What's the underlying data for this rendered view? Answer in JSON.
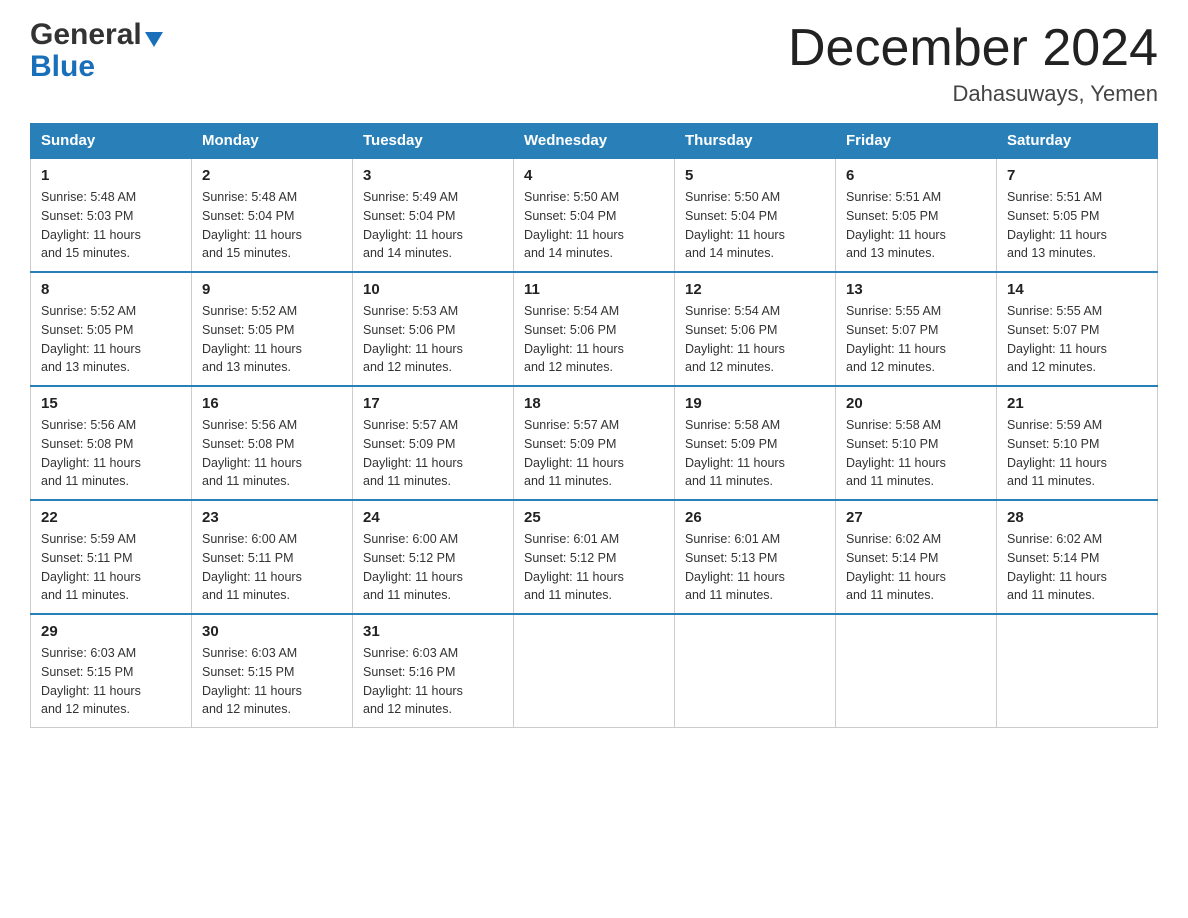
{
  "logo": {
    "general": "General",
    "blue": "Blue"
  },
  "title": "December 2024",
  "location": "Dahasuways, Yemen",
  "headers": [
    "Sunday",
    "Monday",
    "Tuesday",
    "Wednesday",
    "Thursday",
    "Friday",
    "Saturday"
  ],
  "weeks": [
    [
      {
        "day": "1",
        "sunrise": "5:48 AM",
        "sunset": "5:03 PM",
        "daylight": "11 hours and 15 minutes."
      },
      {
        "day": "2",
        "sunrise": "5:48 AM",
        "sunset": "5:04 PM",
        "daylight": "11 hours and 15 minutes."
      },
      {
        "day": "3",
        "sunrise": "5:49 AM",
        "sunset": "5:04 PM",
        "daylight": "11 hours and 14 minutes."
      },
      {
        "day": "4",
        "sunrise": "5:50 AM",
        "sunset": "5:04 PM",
        "daylight": "11 hours and 14 minutes."
      },
      {
        "day": "5",
        "sunrise": "5:50 AM",
        "sunset": "5:04 PM",
        "daylight": "11 hours and 14 minutes."
      },
      {
        "day": "6",
        "sunrise": "5:51 AM",
        "sunset": "5:05 PM",
        "daylight": "11 hours and 13 minutes."
      },
      {
        "day": "7",
        "sunrise": "5:51 AM",
        "sunset": "5:05 PM",
        "daylight": "11 hours and 13 minutes."
      }
    ],
    [
      {
        "day": "8",
        "sunrise": "5:52 AM",
        "sunset": "5:05 PM",
        "daylight": "11 hours and 13 minutes."
      },
      {
        "day": "9",
        "sunrise": "5:52 AM",
        "sunset": "5:05 PM",
        "daylight": "11 hours and 13 minutes."
      },
      {
        "day": "10",
        "sunrise": "5:53 AM",
        "sunset": "5:06 PM",
        "daylight": "11 hours and 12 minutes."
      },
      {
        "day": "11",
        "sunrise": "5:54 AM",
        "sunset": "5:06 PM",
        "daylight": "11 hours and 12 minutes."
      },
      {
        "day": "12",
        "sunrise": "5:54 AM",
        "sunset": "5:06 PM",
        "daylight": "11 hours and 12 minutes."
      },
      {
        "day": "13",
        "sunrise": "5:55 AM",
        "sunset": "5:07 PM",
        "daylight": "11 hours and 12 minutes."
      },
      {
        "day": "14",
        "sunrise": "5:55 AM",
        "sunset": "5:07 PM",
        "daylight": "11 hours and 12 minutes."
      }
    ],
    [
      {
        "day": "15",
        "sunrise": "5:56 AM",
        "sunset": "5:08 PM",
        "daylight": "11 hours and 11 minutes."
      },
      {
        "day": "16",
        "sunrise": "5:56 AM",
        "sunset": "5:08 PM",
        "daylight": "11 hours and 11 minutes."
      },
      {
        "day": "17",
        "sunrise": "5:57 AM",
        "sunset": "5:09 PM",
        "daylight": "11 hours and 11 minutes."
      },
      {
        "day": "18",
        "sunrise": "5:57 AM",
        "sunset": "5:09 PM",
        "daylight": "11 hours and 11 minutes."
      },
      {
        "day": "19",
        "sunrise": "5:58 AM",
        "sunset": "5:09 PM",
        "daylight": "11 hours and 11 minutes."
      },
      {
        "day": "20",
        "sunrise": "5:58 AM",
        "sunset": "5:10 PM",
        "daylight": "11 hours and 11 minutes."
      },
      {
        "day": "21",
        "sunrise": "5:59 AM",
        "sunset": "5:10 PM",
        "daylight": "11 hours and 11 minutes."
      }
    ],
    [
      {
        "day": "22",
        "sunrise": "5:59 AM",
        "sunset": "5:11 PM",
        "daylight": "11 hours and 11 minutes."
      },
      {
        "day": "23",
        "sunrise": "6:00 AM",
        "sunset": "5:11 PM",
        "daylight": "11 hours and 11 minutes."
      },
      {
        "day": "24",
        "sunrise": "6:00 AM",
        "sunset": "5:12 PM",
        "daylight": "11 hours and 11 minutes."
      },
      {
        "day": "25",
        "sunrise": "6:01 AM",
        "sunset": "5:12 PM",
        "daylight": "11 hours and 11 minutes."
      },
      {
        "day": "26",
        "sunrise": "6:01 AM",
        "sunset": "5:13 PM",
        "daylight": "11 hours and 11 minutes."
      },
      {
        "day": "27",
        "sunrise": "6:02 AM",
        "sunset": "5:14 PM",
        "daylight": "11 hours and 11 minutes."
      },
      {
        "day": "28",
        "sunrise": "6:02 AM",
        "sunset": "5:14 PM",
        "daylight": "11 hours and 11 minutes."
      }
    ],
    [
      {
        "day": "29",
        "sunrise": "6:03 AM",
        "sunset": "5:15 PM",
        "daylight": "11 hours and 12 minutes."
      },
      {
        "day": "30",
        "sunrise": "6:03 AM",
        "sunset": "5:15 PM",
        "daylight": "11 hours and 12 minutes."
      },
      {
        "day": "31",
        "sunrise": "6:03 AM",
        "sunset": "5:16 PM",
        "daylight": "11 hours and 12 minutes."
      },
      null,
      null,
      null,
      null
    ]
  ],
  "labels": {
    "sunrise": "Sunrise:",
    "sunset": "Sunset:",
    "daylight": "Daylight:"
  }
}
